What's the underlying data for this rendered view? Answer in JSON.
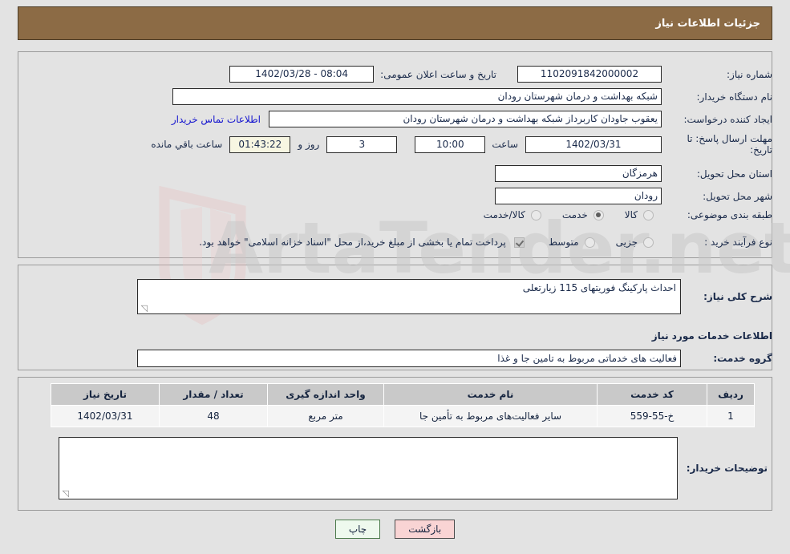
{
  "header": {
    "title": "جزئیات اطلاعات نیاز"
  },
  "top": {
    "need_number_label": "شماره نیاز:",
    "need_number_value": "1102091842000002",
    "announce_datetime_label": "تاریخ و ساعت اعلان عمومی:",
    "announce_datetime_value": "08:04 - 1402/03/28",
    "buyer_org_label": "نام دستگاه خریدار:",
    "buyer_org_value": "شبکه بهداشت و درمان شهرستان رودان",
    "requester_label": "ایجاد کننده درخواست:",
    "requester_value": "یعقوب جاودان کاربرداز شبکه بهداشت و درمان شهرستان رودان",
    "contact_link": "اطلاعات تماس خریدار",
    "deadline_label": "مهلت ارسال پاسخ: تا تاریخ:",
    "deadline_date": "1402/03/31",
    "hour_label": "ساعت",
    "hour_value": "10:00",
    "days_value": "3",
    "days_label": "روز و",
    "countdown_value": "01:43:22",
    "countdown_label": "ساعت باقي مانده",
    "province_label": "استان محل تحویل:",
    "province_value": "هرمزگان",
    "city_label": "شهر محل تحویل:",
    "city_value": "رودان",
    "category_label": "طبقه بندی موضوعی:",
    "category_options": [
      {
        "label": "کالا",
        "selected": false
      },
      {
        "label": "خدمت",
        "selected": true
      },
      {
        "label": "کالا/خدمت",
        "selected": false
      }
    ],
    "process_label": "نوع فرآیند خرید :",
    "process_options": [
      {
        "label": "جزیی",
        "selected": false
      },
      {
        "label": "متوسط",
        "selected": false
      }
    ],
    "treasury_note": "پرداخت تمام یا بخشی از مبلغ خرید،از محل \"اسناد خزانه اسلامی\" خواهد بود."
  },
  "middle": {
    "general_desc_label": "شرح کلی نیاز:",
    "general_desc_value": "احداث پارکینگ فوریتهای 115 زیارتعلی",
    "services_info_heading": "اطلاعات خدمات مورد نیاز",
    "service_group_label": "گروه خدمت:",
    "service_group_value": "فعالیت های خدماتی مربوط به تامین جا و غذا"
  },
  "table": {
    "columns": [
      "ردیف",
      "کد خدمت",
      "نام خدمت",
      "واحد اندازه گیری",
      "تعداد / مقدار",
      "تاریخ نیاز"
    ],
    "rows": [
      {
        "index": "1",
        "service_code": "خ-55-559",
        "service_name": "سایر فعالیت‌های مربوط به تأمین جا",
        "unit": "متر مربع",
        "quantity": "48",
        "need_date": "1402/03/31"
      }
    ]
  },
  "bottom": {
    "buyer_notes_label": "توضیحات خریدار:",
    "buyer_notes_value": ""
  },
  "buttons": {
    "back": "بازگشت",
    "print": "چاپ"
  },
  "watermark": {
    "text": "ArtaTender.net"
  },
  "colors": {
    "header_bg": "#8c6b45",
    "page_bg": "#e3e3e3",
    "link": "#1414cf",
    "back_btn": "#f9d4d4",
    "print_btn": "#eef9ee",
    "countdown_bg": "#f7f6e2"
  }
}
